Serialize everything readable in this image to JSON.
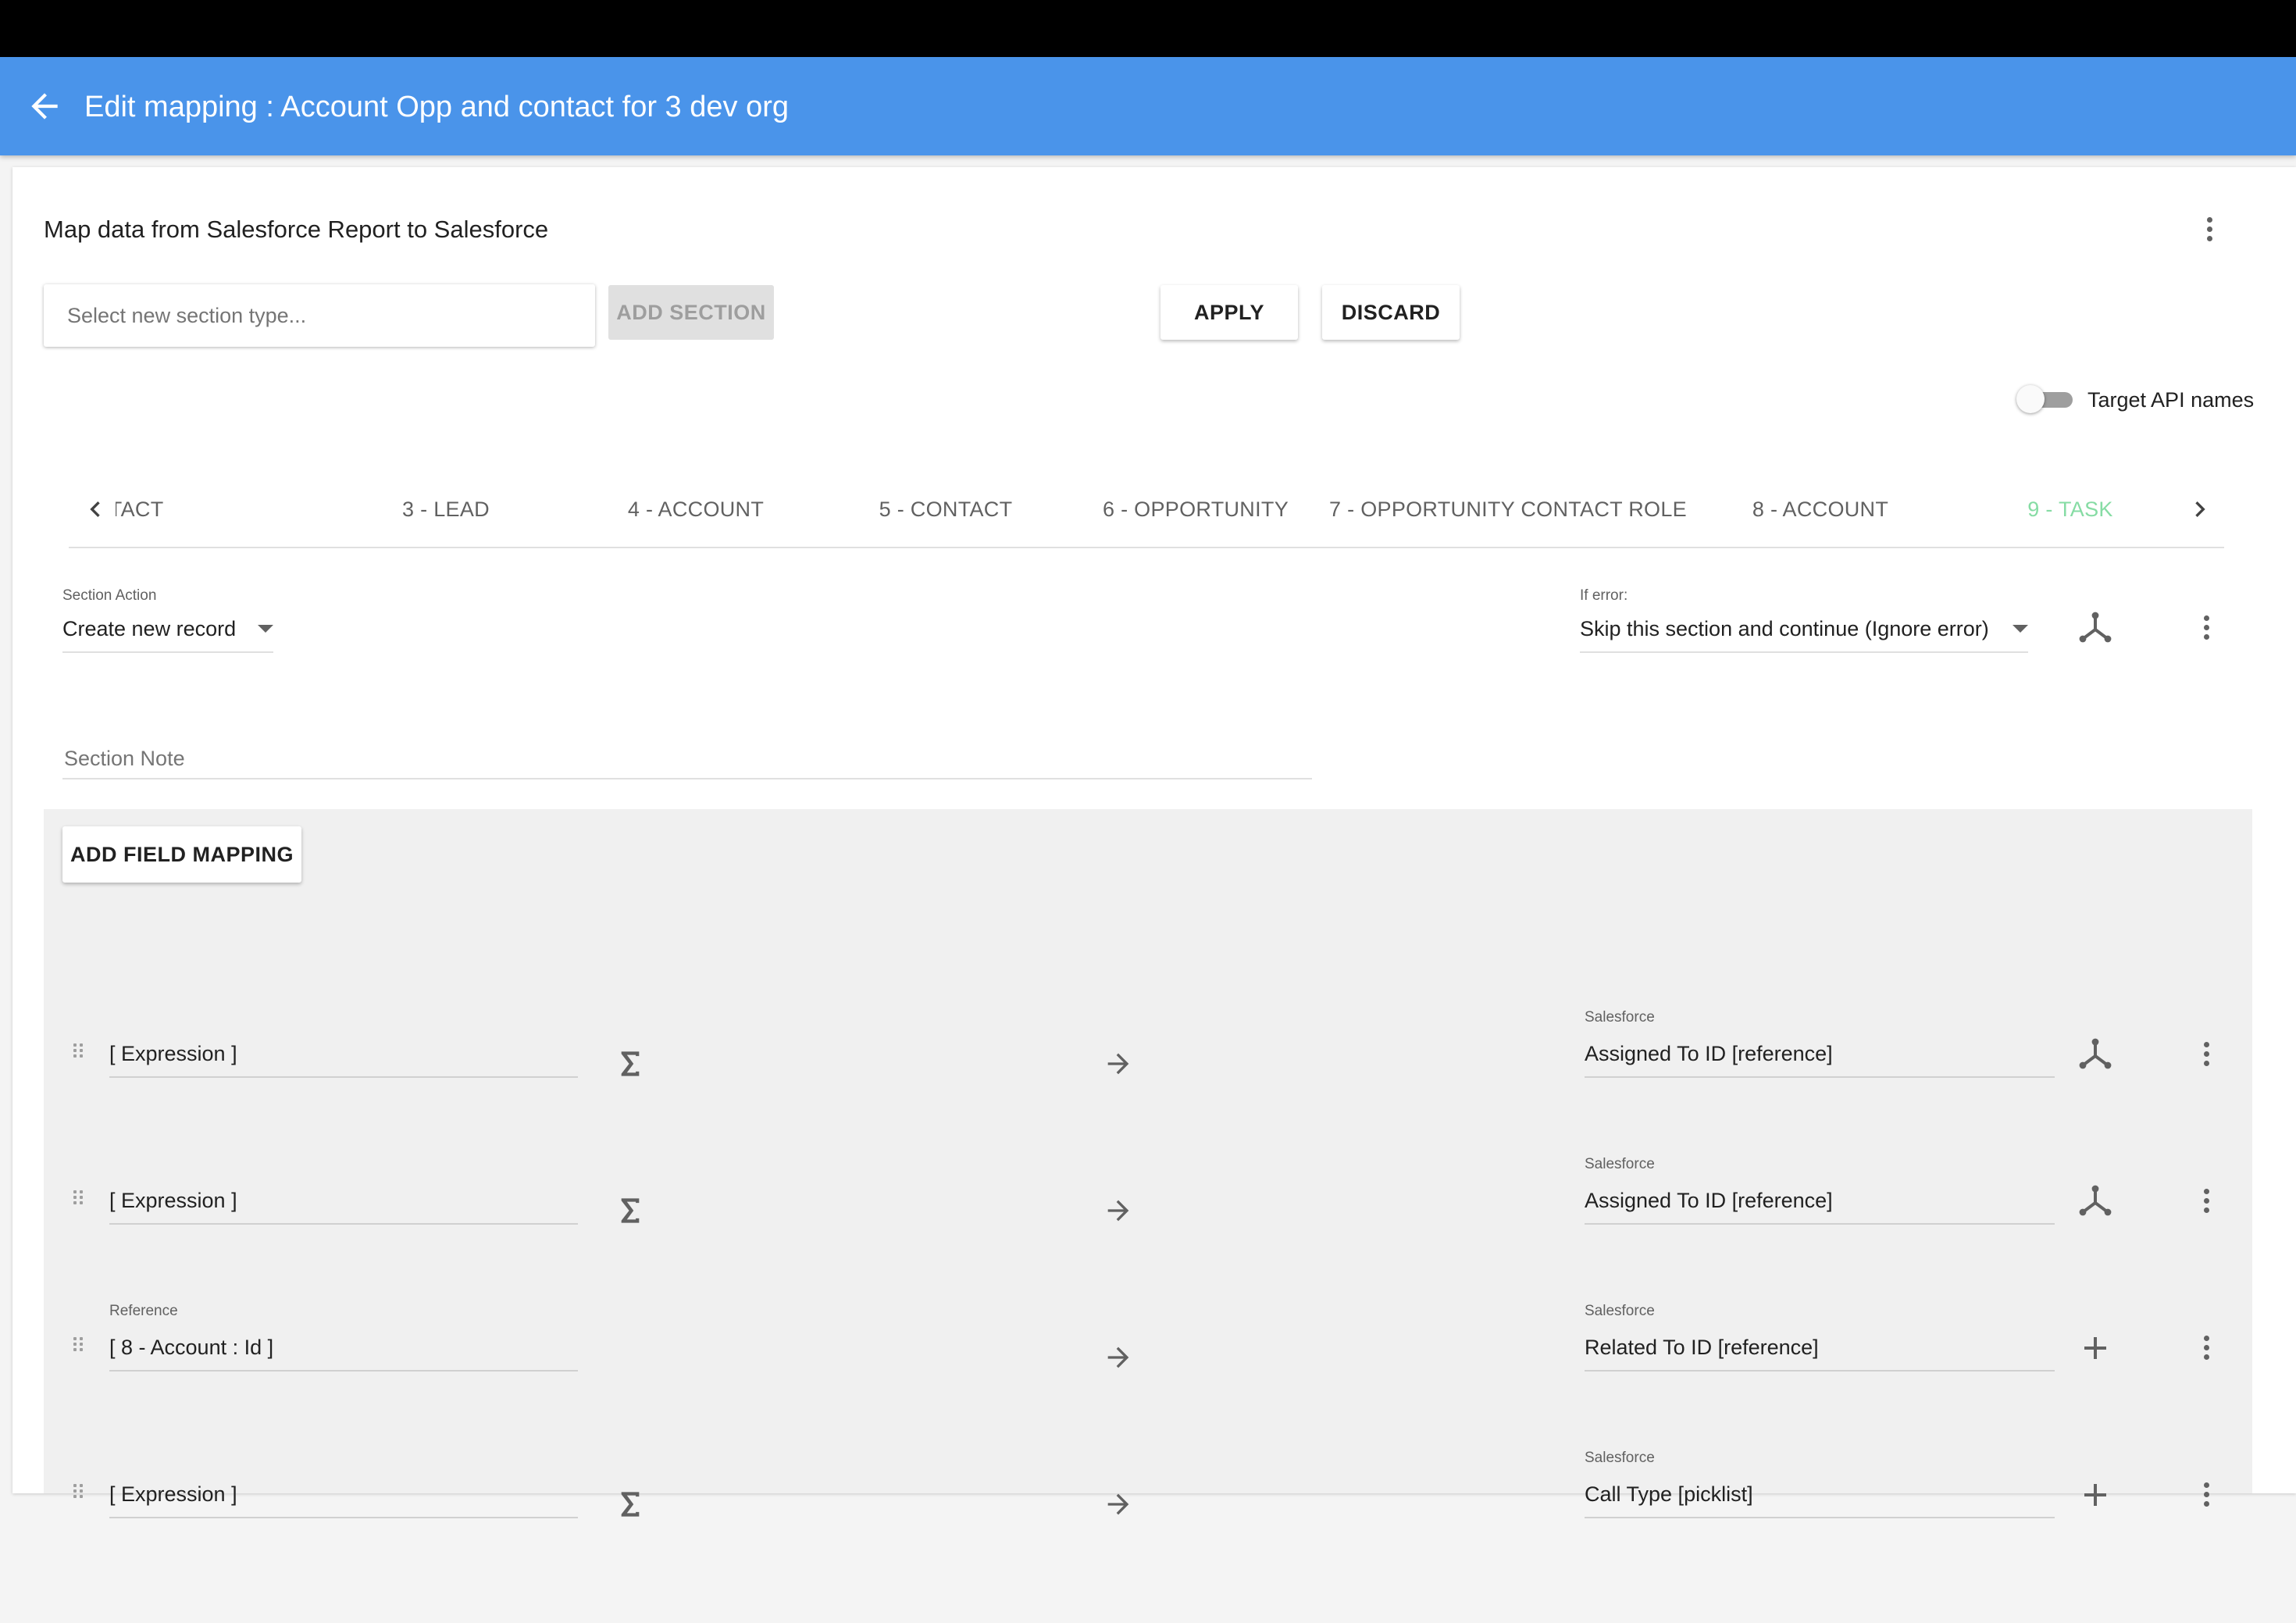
{
  "header": {
    "title": "Edit mapping : Account Opp and contact for 3 dev org"
  },
  "card": {
    "subtitle": "Map data from Salesforce Report to Salesforce",
    "section_type_placeholder": "Select new section type...",
    "add_section_label": "ADD SECTION",
    "apply_label": "APPLY",
    "discard_label": "DISCARD",
    "target_api_names_label": "Target API names",
    "target_api_names_enabled": false
  },
  "tabs": [
    {
      "label": "NTACT"
    },
    {
      "label": "3 - LEAD"
    },
    {
      "label": "4 - ACCOUNT"
    },
    {
      "label": "5 - CONTACT"
    },
    {
      "label": "6 - OPPORTUNITY"
    },
    {
      "label": "7 - OPPORTUNITY CONTACT ROLE"
    },
    {
      "label": "8 - ACCOUNT"
    },
    {
      "label": "9 - TASK",
      "active": true
    }
  ],
  "section": {
    "action_label": "Section Action",
    "action_value": "Create new record",
    "error_label": "If error:",
    "error_value": "Skip this section and continue (Ignore error)",
    "note_placeholder": "Section Note"
  },
  "mapping": {
    "add_field_mapping_label": "ADD FIELD MAPPING",
    "rows": [
      {
        "source_label": "",
        "source_value": "[ Expression ]",
        "target_label": "Salesforce",
        "target_value": "Assigned To ID [reference]",
        "action_icon": "hierarchy-icon"
      },
      {
        "source_label": "",
        "source_value": "[ Expression ]",
        "target_label": "Salesforce",
        "target_value": "Assigned To ID [reference]",
        "action_icon": "hierarchy-icon"
      },
      {
        "source_label": "Reference",
        "source_value": "[ 8 - Account : Id ]",
        "target_label": "Salesforce",
        "target_value": "Related To ID [reference]",
        "action_icon": "plus-icon"
      },
      {
        "source_label": "",
        "source_value": "[ Expression ]",
        "target_label": "Salesforce",
        "target_value": "Call Type [picklist]",
        "action_icon": "plus-icon"
      }
    ]
  },
  "colors": {
    "app_bar": "#4a94ea",
    "active_tab": "#86dca4"
  }
}
